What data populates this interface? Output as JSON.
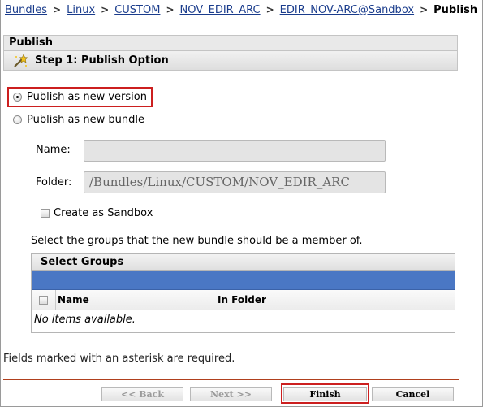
{
  "breadcrumb": {
    "items": [
      "Bundles",
      "Linux",
      "CUSTOM",
      "NOV_EDIR_ARC",
      "EDIR_NOV-ARC@Sandbox"
    ],
    "current": "Publish",
    "separator": ">"
  },
  "panel": {
    "title": "Publish"
  },
  "step": {
    "title": "Step 1: Publish Option",
    "icon": "wizard-wand-icon"
  },
  "options": {
    "new_version": {
      "label": "Publish as new version",
      "selected": true
    },
    "new_bundle": {
      "label": "Publish as new bundle",
      "selected": false
    }
  },
  "form": {
    "name_label": "Name:",
    "name_value": "",
    "folder_label": "Folder:",
    "folder_value": "/Bundles/Linux/CUSTOM/NOV_EDIR_ARC",
    "sandbox_label": "Create as Sandbox",
    "sandbox_checked": false
  },
  "groups": {
    "instruction": "Select the groups that the new bundle should be a member of.",
    "title": "Select Groups",
    "columns": [
      "Name",
      "In Folder"
    ],
    "empty_text": "No items available."
  },
  "required_note": "Fields marked with an asterisk are required.",
  "buttons": {
    "back": "<< Back",
    "next": "Next >>",
    "finish": "Finish",
    "cancel": "Cancel"
  },
  "colors": {
    "highlight": "#cc1f1f",
    "link": "#1a3c8c",
    "toolbar": "#4a77c4",
    "footer_line": "#b0401e"
  }
}
